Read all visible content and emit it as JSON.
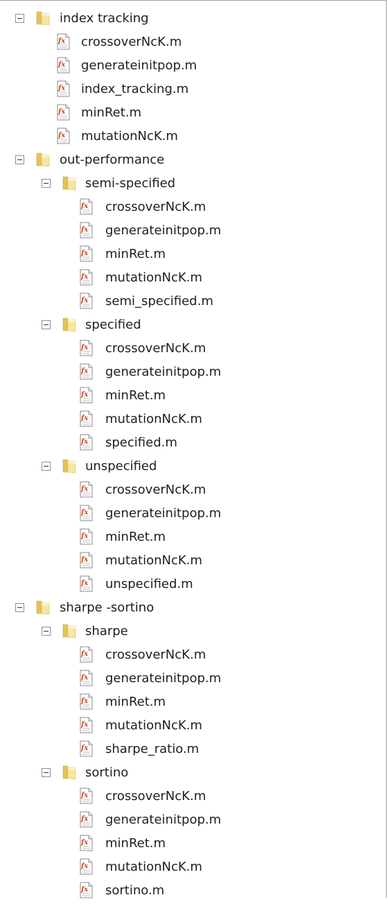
{
  "tree": [
    {
      "label": "index tracking",
      "depth": 0,
      "type": "folder"
    },
    {
      "label": "crossoverNcK.m",
      "depth": 1,
      "type": "file"
    },
    {
      "label": "generateinitpop.m",
      "depth": 1,
      "type": "file"
    },
    {
      "label": "index_tracking.m",
      "depth": 1,
      "type": "file"
    },
    {
      "label": "minRet.m",
      "depth": 1,
      "type": "file"
    },
    {
      "label": "mutationNcK.m",
      "depth": 1,
      "type": "file"
    },
    {
      "label": "out-performance",
      "depth": 0,
      "type": "folder"
    },
    {
      "label": "semi-specified",
      "depth": 1,
      "type": "folder"
    },
    {
      "label": "crossoverNcK.m",
      "depth": 2,
      "type": "file"
    },
    {
      "label": "generateinitpop.m",
      "depth": 2,
      "type": "file"
    },
    {
      "label": "minRet.m",
      "depth": 2,
      "type": "file"
    },
    {
      "label": "mutationNcK.m",
      "depth": 2,
      "type": "file"
    },
    {
      "label": "semi_specified.m",
      "depth": 2,
      "type": "file"
    },
    {
      "label": "specified",
      "depth": 1,
      "type": "folder"
    },
    {
      "label": "crossoverNcK.m",
      "depth": 2,
      "type": "file"
    },
    {
      "label": "generateinitpop.m",
      "depth": 2,
      "type": "file"
    },
    {
      "label": "minRet.m",
      "depth": 2,
      "type": "file"
    },
    {
      "label": "mutationNcK.m",
      "depth": 2,
      "type": "file"
    },
    {
      "label": "specified.m",
      "depth": 2,
      "type": "file"
    },
    {
      "label": "unspecified",
      "depth": 1,
      "type": "folder"
    },
    {
      "label": "crossoverNcK.m",
      "depth": 2,
      "type": "file"
    },
    {
      "label": "generateinitpop.m",
      "depth": 2,
      "type": "file"
    },
    {
      "label": "minRet.m",
      "depth": 2,
      "type": "file"
    },
    {
      "label": "mutationNcK.m",
      "depth": 2,
      "type": "file"
    },
    {
      "label": "unspecified.m",
      "depth": 2,
      "type": "file"
    },
    {
      "label": "sharpe -sortino",
      "depth": 0,
      "type": "folder"
    },
    {
      "label": "sharpe",
      "depth": 1,
      "type": "folder"
    },
    {
      "label": "crossoverNcK.m",
      "depth": 2,
      "type": "file"
    },
    {
      "label": "generateinitpop.m",
      "depth": 2,
      "type": "file"
    },
    {
      "label": "minRet.m",
      "depth": 2,
      "type": "file"
    },
    {
      "label": "mutationNcK.m",
      "depth": 2,
      "type": "file"
    },
    {
      "label": "sharpe_ratio.m",
      "depth": 2,
      "type": "file"
    },
    {
      "label": "sortino",
      "depth": 1,
      "type": "folder"
    },
    {
      "label": "crossoverNcK.m",
      "depth": 2,
      "type": "file"
    },
    {
      "label": "generateinitpop.m",
      "depth": 2,
      "type": "file"
    },
    {
      "label": "minRet.m",
      "depth": 2,
      "type": "file"
    },
    {
      "label": "mutationNcK.m",
      "depth": 2,
      "type": "file"
    },
    {
      "label": "sortino.m",
      "depth": 2,
      "type": "file"
    }
  ],
  "colors": {
    "folder_light": "#f8e6a0",
    "folder_dark": "#e3c25a",
    "file_border": "#8a8a8a",
    "fx_color": "#d04a18"
  }
}
